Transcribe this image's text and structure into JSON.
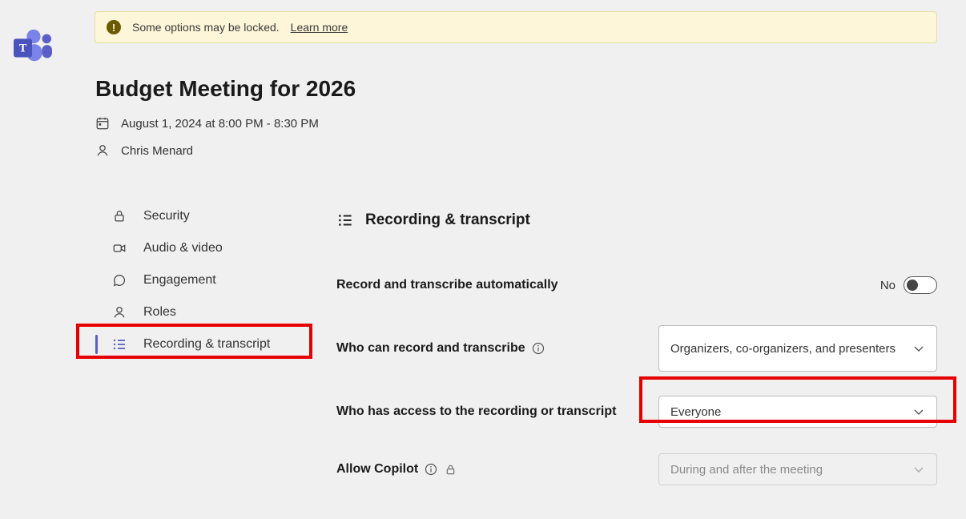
{
  "banner": {
    "text": "Some options may be locked.",
    "link": "Learn more"
  },
  "meeting": {
    "title": "Budget Meeting for 2026",
    "datetime": "August 1, 2024 at 8:00 PM - 8:30 PM",
    "organizer": "Chris Menard"
  },
  "sidebar": {
    "items": [
      {
        "label": "Security"
      },
      {
        "label": "Audio & video"
      },
      {
        "label": "Engagement"
      },
      {
        "label": "Roles"
      },
      {
        "label": "Recording & transcript"
      }
    ]
  },
  "section": {
    "title": "Recording & transcript"
  },
  "settings": {
    "auto_record": {
      "label": "Record and transcribe automatically",
      "value_text": "No"
    },
    "who_can_record": {
      "label": "Who can record and transcribe",
      "value": "Organizers, co-organizers, and presenters"
    },
    "who_has_access": {
      "label": "Who has access to the recording or transcript",
      "value": "Everyone"
    },
    "allow_copilot": {
      "label": "Allow Copilot",
      "value": "During and after the meeting"
    }
  }
}
